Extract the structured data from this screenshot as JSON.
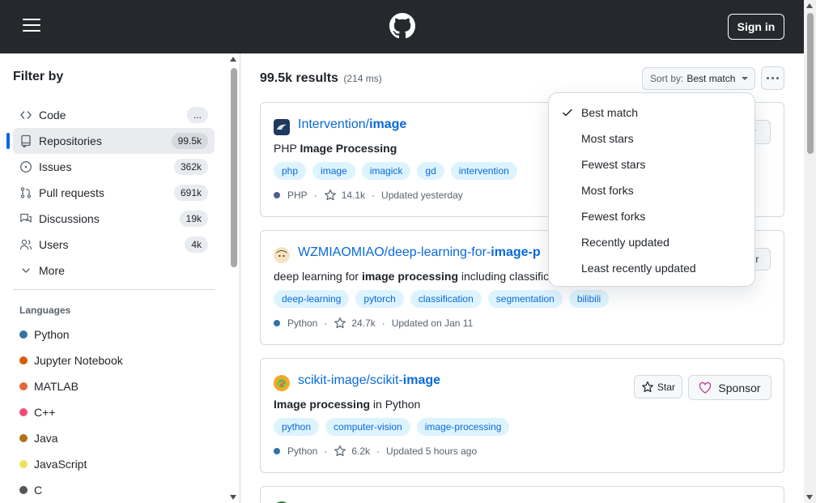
{
  "header": {
    "menu_icon": "hamburger-icon",
    "logo_icon": "github-logo-icon",
    "signin_label": "Sign in"
  },
  "sidebar": {
    "title": "Filter by",
    "items": [
      {
        "label": "Code",
        "count": "...",
        "icon": "code-icon"
      },
      {
        "label": "Repositories",
        "count": "99.5k",
        "icon": "repo-icon",
        "selected": true
      },
      {
        "label": "Issues",
        "count": "362k",
        "icon": "issue-icon"
      },
      {
        "label": "Pull requests",
        "count": "691k",
        "icon": "pull-request-icon"
      },
      {
        "label": "Discussions",
        "count": "19k",
        "icon": "discussion-icon"
      },
      {
        "label": "Users",
        "count": "4k",
        "icon": "people-icon"
      },
      {
        "label": "More",
        "count": "",
        "icon": "chevron-down-icon"
      }
    ],
    "languages_title": "Languages",
    "languages": [
      {
        "name": "Python",
        "color": "#3572A5"
      },
      {
        "name": "Jupyter Notebook",
        "color": "#DA5B0B"
      },
      {
        "name": "MATLAB",
        "color": "#e16737"
      },
      {
        "name": "C++",
        "color": "#f34b7d"
      },
      {
        "name": "Java",
        "color": "#b07219"
      },
      {
        "name": "JavaScript",
        "color": "#f1e05a"
      },
      {
        "name": "C",
        "color": "#555555"
      }
    ]
  },
  "results": {
    "count": "99.5k results",
    "time": "(214 ms)",
    "sort_prefix": "Sort by:",
    "sort_value": "Best match"
  },
  "repos": [
    {
      "owner": "Intervention/",
      "name": "image",
      "desc_pre": "PHP ",
      "desc_bold": "Image Processing",
      "desc_post": "",
      "topics": [
        "php",
        "image",
        "imagick",
        "gd",
        "intervention"
      ],
      "language": "PHP",
      "language_color": "#4F5D95",
      "stars": "14.1k",
      "updated": "Updated yesterday"
    },
    {
      "owner": "WZMIAOMIAO/deep-learning-for-",
      "name": "image-p",
      "desc_pre": "deep learning for ",
      "desc_bold": "image processing",
      "desc_post": " including classifica",
      "topics": [
        "deep-learning",
        "pytorch",
        "classification",
        "segmentation",
        "bilibili"
      ],
      "language": "Python",
      "language_color": "#3572A5",
      "stars": "24.7k",
      "updated": "Updated on Jan 11"
    },
    {
      "owner": "scikit-image/scikit-",
      "name": "image",
      "desc_pre": "",
      "desc_bold": "Image processing",
      "desc_post": " in Python",
      "topics": [
        "python",
        "computer-vision",
        "image-processing"
      ],
      "language": "Python",
      "language_color": "#3572A5",
      "stars": "6.2k",
      "updated": "Updated 5 hours ago",
      "star_label": "Star",
      "sponsor_label": "Sponsor"
    }
  ],
  "partial_buttons": {
    "first": "r",
    "second": "ar"
  },
  "sort_menu": {
    "items": [
      {
        "label": "Best match",
        "checked": true
      },
      {
        "label": "Most stars",
        "checked": false
      },
      {
        "label": "Fewest stars",
        "checked": false
      },
      {
        "label": "Most forks",
        "checked": false
      },
      {
        "label": "Fewest forks",
        "checked": false
      },
      {
        "label": "Recently updated",
        "checked": false
      },
      {
        "label": "Least recently updated",
        "checked": false
      }
    ]
  }
}
